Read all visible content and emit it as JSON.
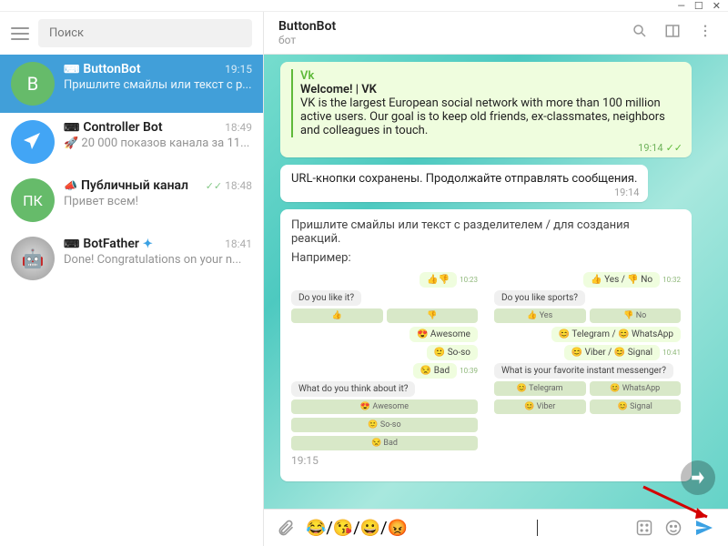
{
  "window": {
    "minimize": "—",
    "maximize": "☐",
    "close": "✕"
  },
  "sidebar": {
    "search_placeholder": "Поиск",
    "items": [
      {
        "name": "ButtonBot",
        "time": "19:15",
        "preview": "Пришлите смайлы или текст с р...",
        "avatar_letter": "B",
        "icon": "bot"
      },
      {
        "name": "Controller Bot",
        "time": "18:49",
        "preview": "🚀 20 000 показов канала за 11...",
        "icon": "bot"
      },
      {
        "name": "Публичный канал",
        "time": "18:48",
        "preview": "Привет всем!",
        "avatar_letter": "ПК",
        "icon": "channel",
        "checks": "✓✓"
      },
      {
        "name": "BotFather",
        "time": "18:41",
        "preview": "Done! Congratulations on your n...",
        "icon": "bot",
        "verified": true
      }
    ]
  },
  "header": {
    "title": "ButtonBot",
    "subtitle": "бот"
  },
  "messages": {
    "vk": {
      "source": "Vk",
      "title": "Welcome! | VK",
      "body": "VK is the largest European social network with more than 100 million active users. Our goal is to keep old friends, ex-classmates, neighbors and colleagues in touch.",
      "time": "19:14"
    },
    "saved": {
      "text": "URL-кнопки сохранены. Продолжайте отправлять сообщения.",
      "time": "19:14"
    },
    "instruct": {
      "lead": "Пришлите смайлы или текст с разделителем / для создания реакций.",
      "label": "Например:",
      "col1": {
        "reacts": "👍👎",
        "q1": "Do you like it?",
        "q2": "What do you think about it?",
        "awesome": "😍 Awesome",
        "soso": "🙂 So-so",
        "bad": "😒 Bad",
        "t1": "10:23",
        "t2": "10:39"
      },
      "col2": {
        "reacts": "👍 Yes / 👎 No",
        "q1": "Do you like sports?",
        "yes": "👍 Yes",
        "no": "👎 No",
        "tg": "😊 Telegram / 😊 WhatsApp",
        "vb": "😊 Viber / 😊 Signal",
        "q2": "What is your favorite instant messenger?",
        "telegram": "😊 Telegram",
        "whatsapp": "😊 WhatsApp",
        "viber": "😊 Viber",
        "signal": "😊 Signal",
        "t1": "10:32",
        "t2": "10:41"
      },
      "time": "19:15"
    }
  },
  "composer": {
    "draft": "😂/😘/😀/😡"
  }
}
